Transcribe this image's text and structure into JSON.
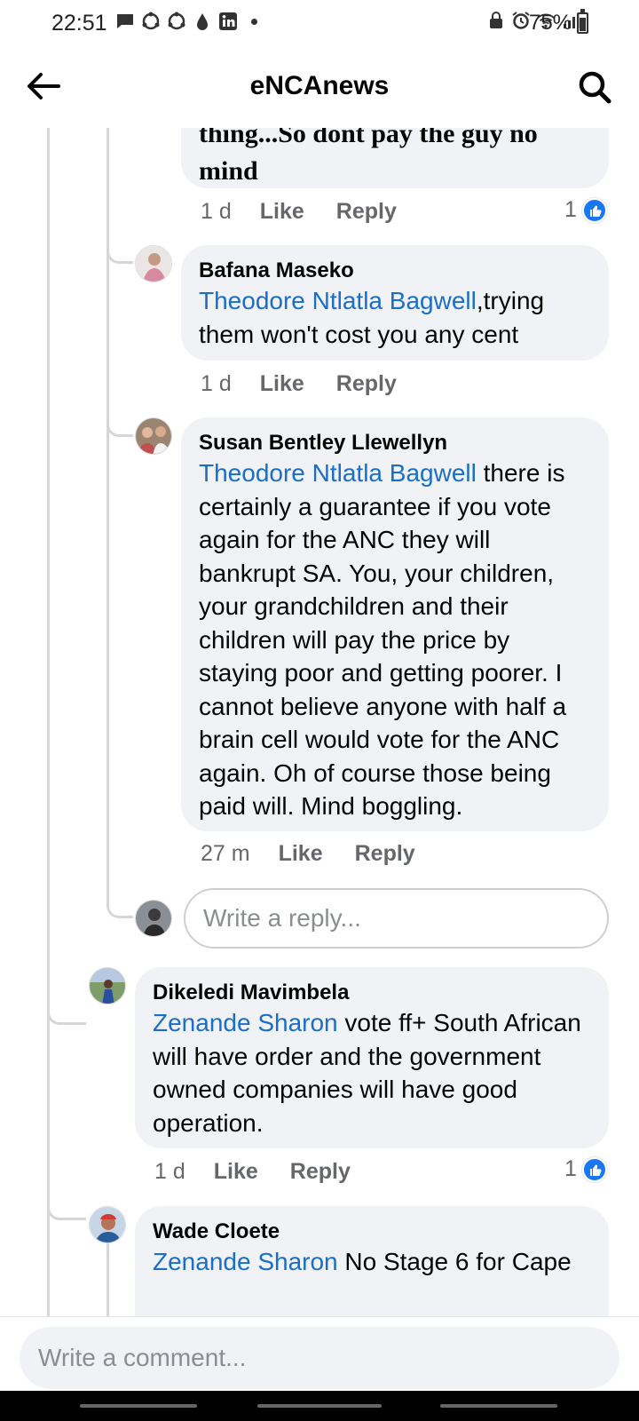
{
  "status_bar": {
    "time": "22:51",
    "battery": "75%",
    "battery_level": 0.75
  },
  "header": {
    "title": "eNCAnews"
  },
  "comments": [
    {
      "text_visible": "thing...So dont pay the guy no",
      "text_line2": "mind",
      "time": "1 d",
      "like": "Like",
      "reply": "Reply",
      "reaction_count": "1"
    },
    {
      "author": "Bafana Maseko",
      "mention": "Theodore Ntlatla Bagwell",
      "text": ",trying them won't cost you any cent",
      "time": "1 d",
      "like": "Like",
      "reply": "Reply"
    },
    {
      "author": "Susan Bentley Llewellyn",
      "mention": "Theodore Ntlatla Bagwell",
      "text": " there is certainly a guarantee if you vote again for the ANC they will bankrupt SA.  You,  your children, your grandchildren and their children will pay the price by staying poor and getting poorer. I cannot believe anyone with half a brain cell would vote for the ANC again.  Oh of course those being paid  will. Mind boggling.",
      "time": "27 m",
      "like": "Like",
      "reply": "Reply"
    },
    {
      "author": "Dikeledi Mavimbela",
      "mention": "Zenande Sharon",
      "text": " vote ff+ South African will have order and the government owned companies will have good operation.",
      "time": "1 d",
      "like": "Like",
      "reply": "Reply",
      "reaction_count": "1"
    },
    {
      "author": "Wade Cloete",
      "mention": "Zenande Sharon",
      "text": " No Stage 6 for Cape"
    }
  ],
  "reply_input": {
    "placeholder": "Write a reply..."
  },
  "comment_bar": {
    "placeholder": "Write a comment..."
  },
  "colors": {
    "mention": "#1a6ec7",
    "bubble": "#f0f2f5",
    "like_blue": "#1877f2"
  }
}
